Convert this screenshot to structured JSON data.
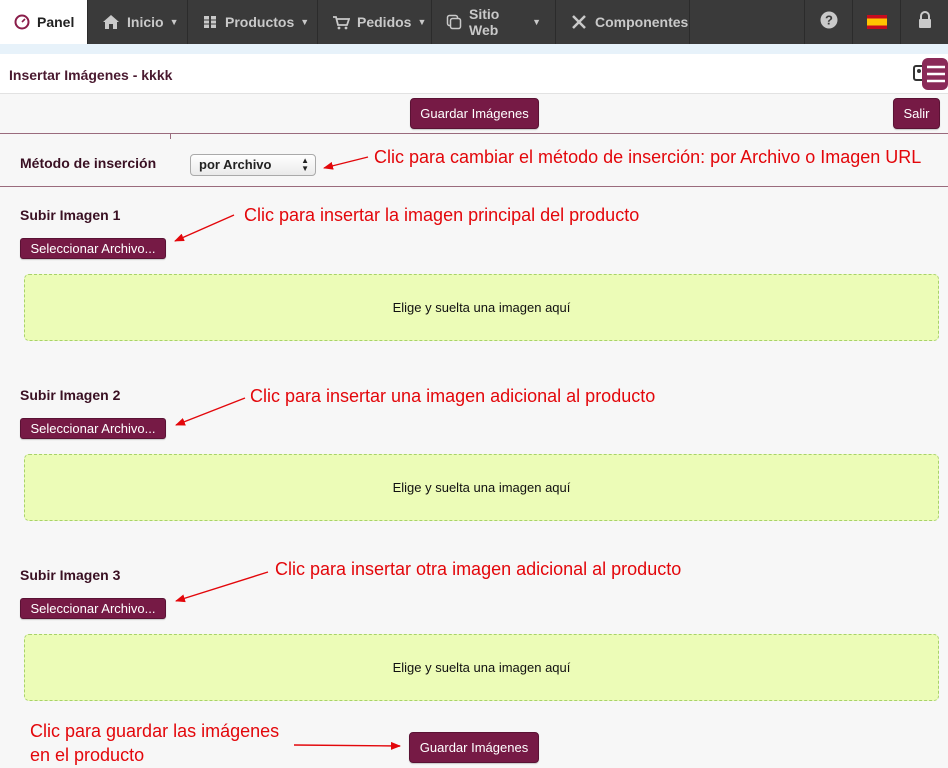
{
  "nav": {
    "panel": "Panel",
    "items": [
      {
        "label": "Inicio"
      },
      {
        "label": "Productos"
      },
      {
        "label": "Pedidos"
      },
      {
        "label": "Sitio Web"
      },
      {
        "label": "Componentes"
      }
    ]
  },
  "page": {
    "title": "Insertar Imágenes - kkkk"
  },
  "toolbar": {
    "save_label": "Guardar Imágenes",
    "exit_label": "Salir"
  },
  "method": {
    "label": "Método de inserción",
    "value": "por Archivo"
  },
  "uploads": [
    {
      "label": "Subir Imagen 1",
      "button": "Seleccionar Archivo...",
      "dropzone": "Elige y suelta una imagen aquí"
    },
    {
      "label": "Subir Imagen 2",
      "button": "Seleccionar Archivo...",
      "dropzone": "Elige y suelta una imagen aquí"
    },
    {
      "label": "Subir Imagen 3",
      "button": "Seleccionar Archivo...",
      "dropzone": "Elige y suelta una imagen aquí"
    }
  ],
  "bottom": {
    "save_label": "Guardar Imágenes"
  },
  "annotations": {
    "method": "Clic para cambiar el método de inserción: por Archivo o Imagen URL",
    "image1": "Clic para insertar la imagen principal del producto",
    "image2": "Clic para insertar una imagen adicional al producto",
    "image3": "Clic para insertar otra imagen adicional al producto",
    "save_line1": "Clic para guardar las imágenes",
    "save_line2": "en el producto"
  },
  "colors": {
    "navbar": "#3a3a3a",
    "accent": "#761a45",
    "dropzone": "#ecfcb7",
    "annotation": "#e3070b"
  }
}
